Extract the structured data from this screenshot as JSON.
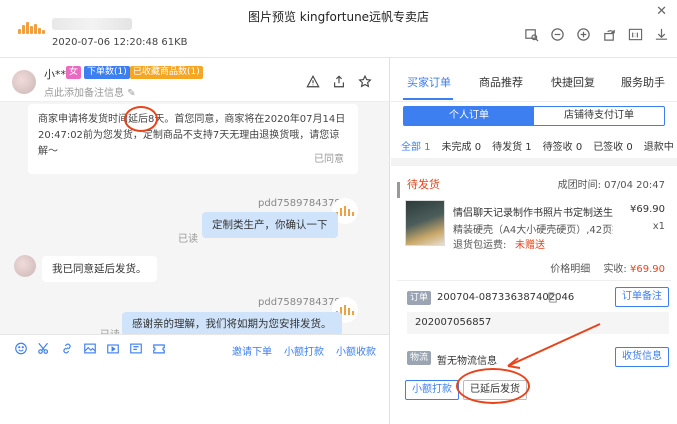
{
  "window": {
    "title": "图片预览 kingfortune远帆专卖店",
    "file_info": "2020-07-06 12:20:48 61KB",
    "close": "✕"
  },
  "chat": {
    "customer_name": "小**",
    "badge_gender": "女",
    "badge_orders": "下单数(1)",
    "badge_favorites": "已收藏商品数(1)",
    "remark_placeholder": "点此添加备注信息",
    "system_line1": "商家申请将发货时间延后8天。首您同意，商家将在2020年07月14日",
    "system_line2": "20:47:02前为您发货，定制商品不支持7天无理由退换货哦，请您谅解～",
    "system_status": "已同意",
    "seller_id_1": "pdd75897843782",
    "seller_msg_1": "定制类生产，你确认一下",
    "read_1": "已读",
    "customer_msg": "我已同意延后发货。",
    "seller_id_2": "pdd75897843782",
    "seller_msg_2": "感谢亲的理解，我们将如期为您安排发货。",
    "read_2": "已读",
    "links": {
      "invite": "邀请下单",
      "small_pay": "小额打款",
      "small_collect": "小额收款"
    }
  },
  "right": {
    "tabs": [
      "买家订单",
      "商品推荐",
      "快捷回复",
      "服务助手"
    ],
    "segments": [
      "个人订单",
      "店铺待支付订单"
    ],
    "filters": [
      "全部 1",
      "未完成 0",
      "待发货 1",
      "待签收 0",
      "已签收 0",
      "退款中 0"
    ],
    "order": {
      "status": "待发货",
      "paid_time": "成团时间: 07/04 20:47",
      "title": "情侣聊天记录制作书照片书定制送生日…",
      "sku": "精装硬壳（A4大小硬壳硬页）,42页推荐…",
      "price": "¥69.90",
      "qty": "x1",
      "return_label": "退货包运费:",
      "return_value": "未赠送",
      "price_detail": "价格明细",
      "actual_label": "实收:",
      "actual_amount": "¥69.90",
      "tag_order": "订单",
      "order_no": "200704-087336387402046",
      "btn_remark": "订单备注",
      "order_time": "202007056857",
      "tag_logistics": "物流",
      "logistics": "暂无物流信息",
      "btn_address": "收货信息",
      "btn_small_pay": "小额打款",
      "btn_delayed": "已延后发货"
    }
  },
  "colors": {
    "accent": "#3d7ef0",
    "warn": "#e8441c",
    "annotation": "#e8441c"
  }
}
